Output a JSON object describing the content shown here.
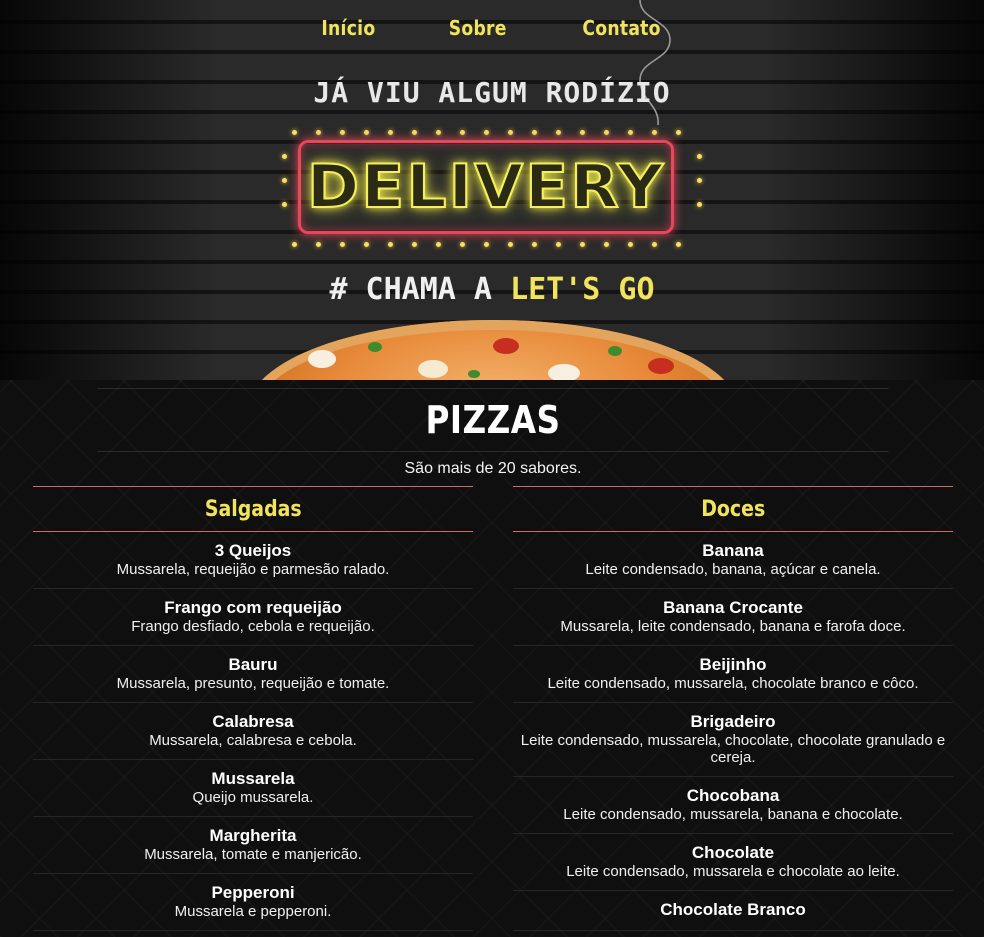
{
  "nav": {
    "items": [
      "Início",
      "Sobre",
      "Contato"
    ]
  },
  "hero": {
    "tagline": "JÁ VIU ALGUM RODÍZIO",
    "sign": "DELIVERY",
    "slogan_prefix": "# CHAMA A ",
    "slogan_highlight": "LET'S GO"
  },
  "menu": {
    "title": "PIZZAS",
    "subtitle": "São mais de 20 sabores.",
    "columns": [
      {
        "heading": "Salgadas",
        "items": [
          {
            "name": "3 Queijos",
            "desc": "Mussarela, requeijão e parmesão ralado."
          },
          {
            "name": "Frango com requeijão",
            "desc": "Frango desfiado, cebola e requeijão."
          },
          {
            "name": "Bauru",
            "desc": "Mussarela, presunto, requeijão e tomate."
          },
          {
            "name": "Calabresa",
            "desc": "Mussarela, calabresa e cebola."
          },
          {
            "name": "Mussarela",
            "desc": "Queijo mussarela."
          },
          {
            "name": "Margherita",
            "desc": "Mussarela, tomate e manjericão."
          },
          {
            "name": "Pepperoni",
            "desc": "Mussarela e pepperoni."
          }
        ]
      },
      {
        "heading": "Doces",
        "items": [
          {
            "name": "Banana",
            "desc": "Leite condensado, banana, açúcar e canela."
          },
          {
            "name": "Banana Crocante",
            "desc": "Mussarela, leite condensado, banana e farofa doce."
          },
          {
            "name": "Beijinho",
            "desc": "Leite condensado, mussarela, chocolate branco e côco."
          },
          {
            "name": "Brigadeiro",
            "desc": "Leite condensado, mussarela, chocolate, chocolate granulado e cereja."
          },
          {
            "name": "Chocobana",
            "desc": "Leite condensado, mussarela, banana e chocolate."
          },
          {
            "name": "Chocolate",
            "desc": "Leite condensado, mussarela e chocolate ao leite."
          },
          {
            "name": "Chocolate Branco",
            "desc": ""
          }
        ]
      }
    ]
  },
  "colors": {
    "accent_yellow": "#f2e35c",
    "divider_red": "#d8646c",
    "neon_red": "#e8475a",
    "background": "#0e0e0e"
  }
}
